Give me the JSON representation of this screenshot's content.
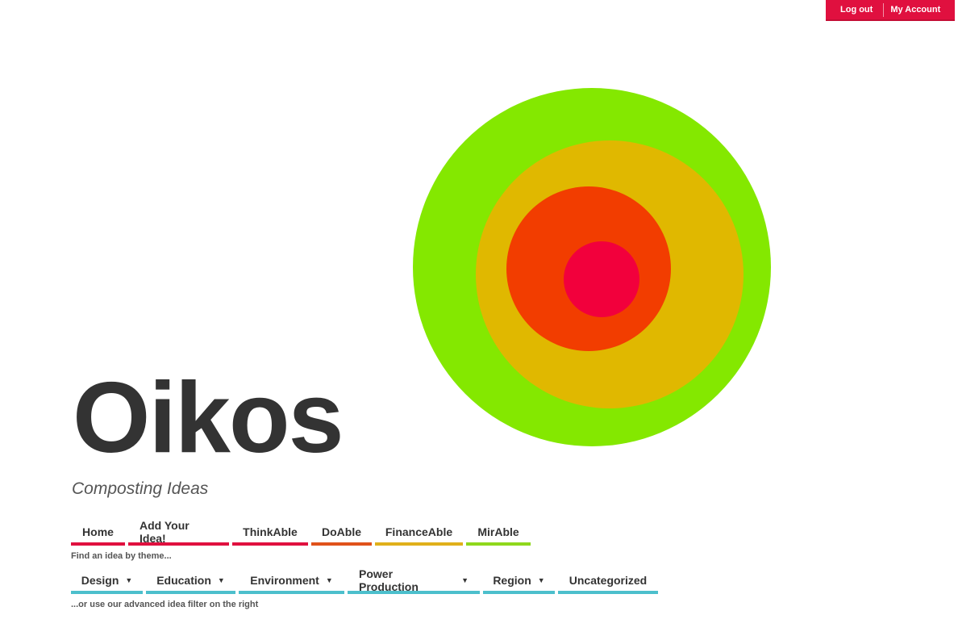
{
  "account_bar": {
    "logout": "Log out",
    "my_account": "My Account"
  },
  "site": {
    "title": "Oikos",
    "tagline": "Composting Ideas"
  },
  "logo": {
    "rings": [
      "#84e800",
      "#e0b800",
      "#f23d00",
      "#f2003c"
    ]
  },
  "main_menu": {
    "items": [
      {
        "label": "Home",
        "color": "#e0103f"
      },
      {
        "label": "Add Your Idea!",
        "color": "#e0103f"
      },
      {
        "label": "ThinkAble",
        "color": "#e0103f"
      },
      {
        "label": "DoAble",
        "color": "#e0521a"
      },
      {
        "label": "FinanceAble",
        "color": "#e0b01a"
      },
      {
        "label": "MirAble",
        "color": "#8fd81c"
      }
    ]
  },
  "themes_hint": "Find an idea by theme...",
  "theme_menu": {
    "items": [
      {
        "label": "Design",
        "dropdown": true
      },
      {
        "label": "Education",
        "dropdown": true
      },
      {
        "label": "Environment",
        "dropdown": true
      },
      {
        "label": "Power Production",
        "dropdown": true
      },
      {
        "label": "Region",
        "dropdown": true
      },
      {
        "label": "Uncategorized",
        "dropdown": false
      }
    ]
  },
  "filter_hint": "...or use our advanced idea filter on the right"
}
